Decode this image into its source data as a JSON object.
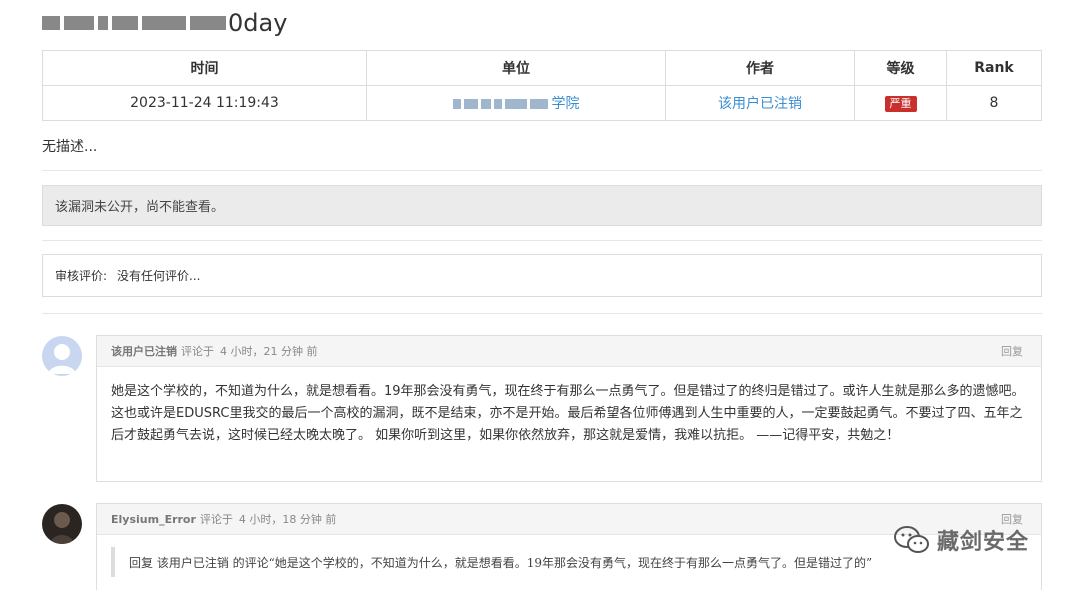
{
  "header": {
    "title_visible": "0day"
  },
  "table": {
    "headers": [
      "时间",
      "单位",
      "作者",
      "等级",
      "Rank"
    ],
    "row": {
      "time": "2023-11-24 11:19:43",
      "unit_visible": "学院",
      "author": "该用户已注销",
      "level": "严重",
      "rank": "8"
    }
  },
  "description": "无描述...",
  "notice": "该漏洞未公开，尚不能查看。",
  "review": {
    "label": "审核评价:",
    "value": "没有任何评价..."
  },
  "comments": [
    {
      "author": "该用户已注销",
      "prefix": "评论于",
      "time": "4 小时，21 分钟 前",
      "reply_label": "回复",
      "body": "她是这个学校的，不知道为什么，就是想看看。19年那会没有勇气，现在终于有那么一点勇气了。但是错过了的终归是错过了。或许人生就是那么多的遗憾吧。这也或许是EDUSRC里我交的最后一个高校的漏洞，既不是结束，亦不是开始。最后希望各位师傅遇到人生中重要的人，一定要鼓起勇气。不要过了四、五年之后才鼓起勇气去说，这时候已经太晚太晚了。 如果你听到这里，如果你依然放弃，那这就是爱情，我难以抗拒。 ——记得平安，共勉之！"
    },
    {
      "author": "Elysium_Error",
      "prefix": "评论于",
      "time": "4 小时，18 分钟 前",
      "reply_label": "回复",
      "quote": "回复 该用户已注销 的评论“她是这个学校的，不知道为什么，就是想看看。19年那会没有勇气，现在终于有那么一点勇气了。但是错过了的”"
    }
  ],
  "watermark": {
    "text": "藏剑安全",
    "icon": "wechat-icon"
  },
  "colors": {
    "link": "#3a8ed1",
    "badge": "#c9302c",
    "notice_bg": "#ebebeb"
  }
}
